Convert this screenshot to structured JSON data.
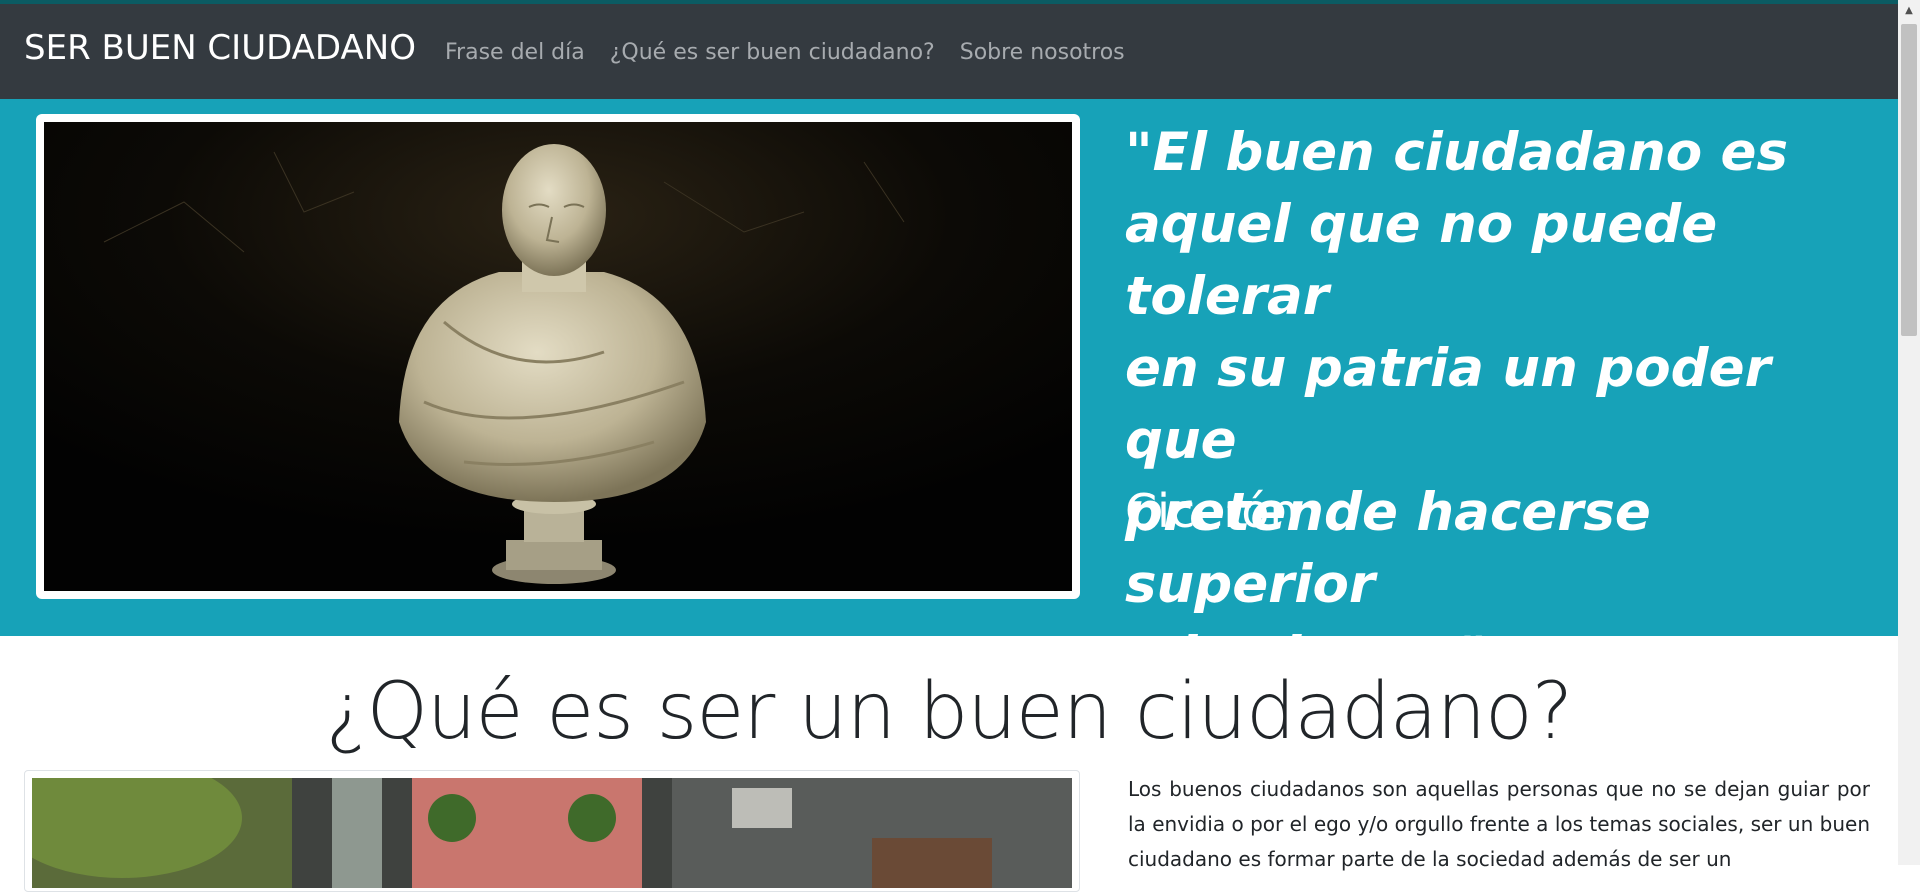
{
  "navbar": {
    "brand": "SER BUEN CIUDADANO",
    "links": [
      "Frase del día",
      "¿Qué es ser buen ciudadano?",
      "Sobre nosotros"
    ]
  },
  "hero": {
    "quote_lines": [
      "\"El buen ciudadano es",
      "aquel que no puede tolerar",
      "en su patria un poder que",
      "pretende hacerse superior",
      "a las leyes.\""
    ],
    "author": "Cicerón"
  },
  "section": {
    "title": "¿Qué es ser un buen ciudadano?",
    "paragraph": "Los buenos ciudadanos son aquellas personas que no se dejan guiar por la envidia o por el ego y/o orgullo frente a los temas sociales, ser un buen ciudadano es formar parte de la sociedad además de ser un"
  },
  "colors": {
    "navbar": "#343a40",
    "hero": "#17a2b8",
    "nav_link": "#a7abaf",
    "text": "#212529"
  },
  "icons": {
    "scroll_up": "triangle-up-icon"
  }
}
